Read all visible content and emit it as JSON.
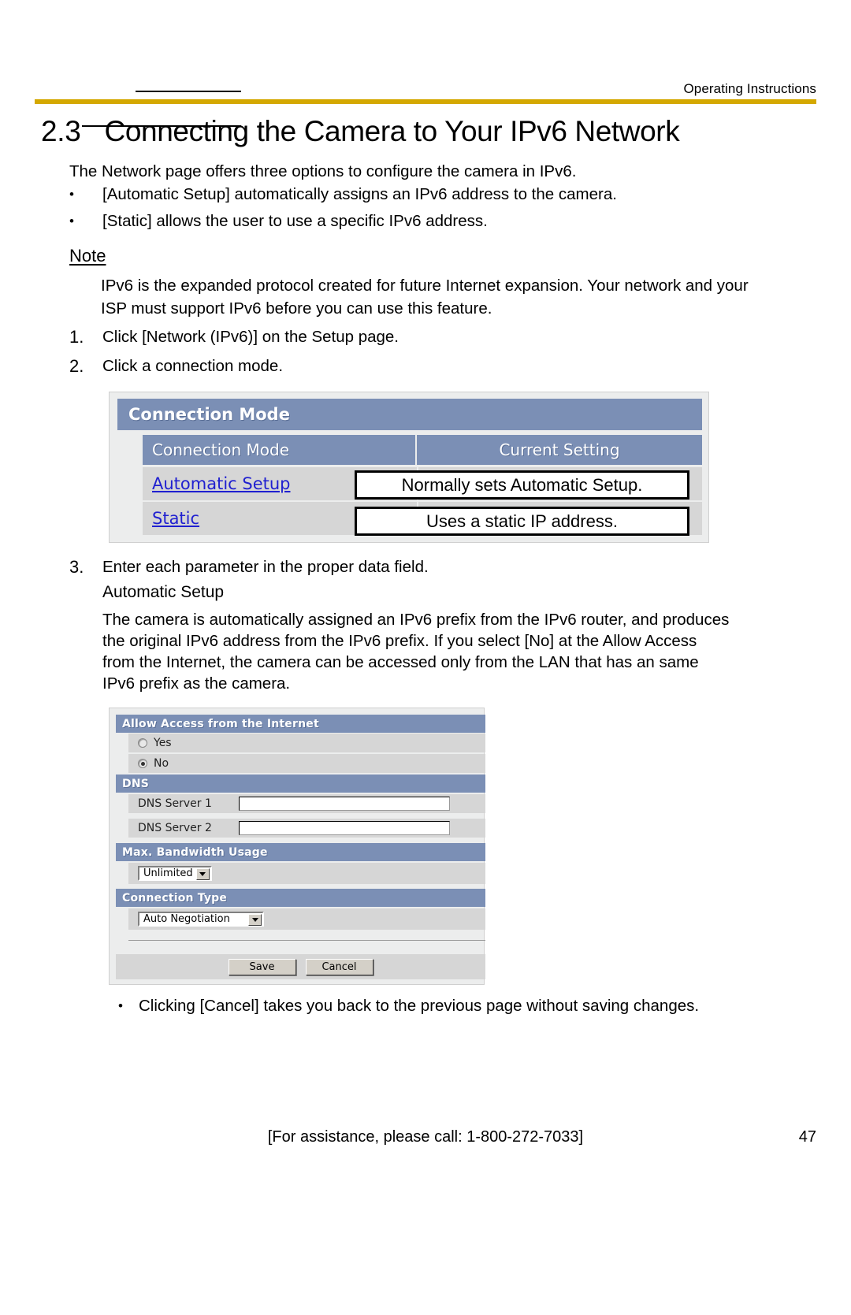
{
  "header": {
    "label": "Operating Instructions",
    "rule_color": "#d4a800"
  },
  "title": {
    "number": "2.3",
    "text": "Connecting the Camera to Your IPv6 Network"
  },
  "intro": "The Network page offers three options to configure the camera in IPv6.",
  "bullets": [
    {
      "marker": "•",
      "text": "[Automatic Setup] automatically assigns an IPv6 address to the camera."
    },
    {
      "marker": "•",
      "text": "[Static] allows the user to use a specific IPv6 address."
    }
  ],
  "note": {
    "heading": "Note",
    "body": "IPv6 is the expanded protocol created for future Internet expansion. Your network and your ISP must support IPv6 before you can use this feature."
  },
  "steps": [
    {
      "number": "1.",
      "text": "Click [Network (IPv6)] on the Setup page."
    },
    {
      "number": "2.",
      "text": "Click a connection mode."
    },
    {
      "number": "3.",
      "text": "Enter each parameter in the proper data field."
    }
  ],
  "step3": {
    "subheading": "Automatic Setup",
    "paragraph": "The camera is automatically assigned an IPv6 prefix from the IPv6 router, and produces the original IPv6 address from the IPv6 prefix. If you select [No] at the Allow Access from the Internet, the camera can be accessed only from the LAN that has an same IPv6 prefix as the camera."
  },
  "connection_mode_panel": {
    "title": "Connection Mode",
    "columns": {
      "mode": "Connection Mode",
      "current": "Current Setting"
    },
    "rows": [
      {
        "link": "Automatic Setup",
        "callout": "Normally sets Automatic Setup."
      },
      {
        "link": "Static",
        "callout": "Uses a static IP address."
      }
    ],
    "colors": {
      "header_band": "#7b8fb5",
      "row_bg": "#d6d6d6",
      "link": "#2020d0",
      "panel_bg": "#eceded"
    }
  },
  "settings_panel": {
    "sections": {
      "allow_access": {
        "title": "Allow Access from the Internet",
        "options": [
          {
            "label": "Yes",
            "selected": false
          },
          {
            "label": "No",
            "selected": true
          }
        ]
      },
      "dns": {
        "title": "DNS",
        "fields": [
          {
            "label": "DNS Server 1",
            "value": "",
            "placeholder": ""
          },
          {
            "label": "DNS Server 2",
            "value": "",
            "placeholder": ""
          }
        ]
      },
      "bandwidth": {
        "title": "Max. Bandwidth Usage",
        "selected": "Unlimited"
      },
      "connection_type": {
        "title": "Connection Type",
        "selected": "Auto Negotiation"
      }
    },
    "buttons": {
      "save": "Save",
      "cancel": "Cancel"
    }
  },
  "closing_bullet": {
    "marker": "•",
    "text": "Clicking [Cancel] takes you back to the previous page without saving changes."
  },
  "footer": {
    "assistance": "[For assistance, please call: 1-800-272-7033]",
    "page": "47"
  }
}
